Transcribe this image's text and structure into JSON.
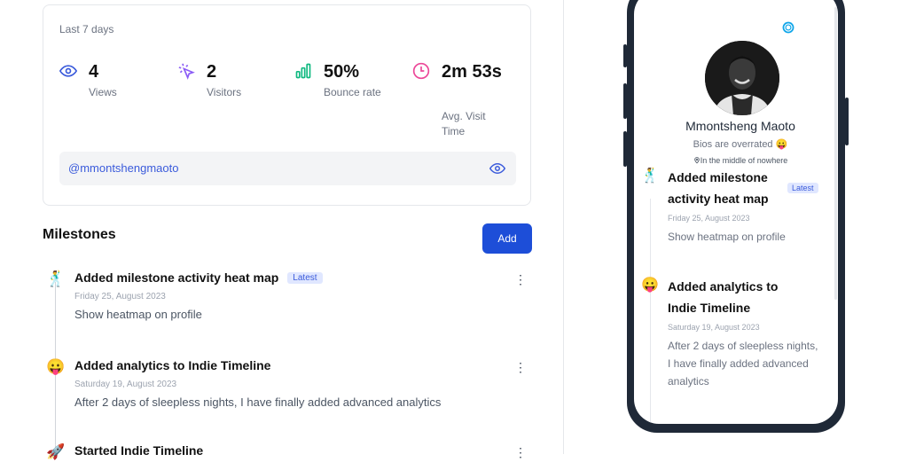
{
  "stats": {
    "period": "Last 7 days",
    "items": [
      {
        "value": "4",
        "label": "Views",
        "icon": "eye-icon",
        "color": "#3b5bdb"
      },
      {
        "value": "2",
        "label": "Visitors",
        "icon": "pointer-click-icon",
        "color": "#8b5cf6"
      },
      {
        "value": "50%",
        "label": "Bounce rate",
        "icon": "bar-chart-icon",
        "color": "#10b981"
      },
      {
        "value": "2m 53s",
        "label": "Avg. Visit Time",
        "icon": "clock-icon",
        "color": "#ec4899"
      }
    ],
    "handle": "@mmontshengmaoto"
  },
  "milestones": {
    "title": "Milestones",
    "add_label": "Add",
    "items": [
      {
        "title": "Added milestone activity heat map",
        "badge": "Latest",
        "date": "Friday 25, August 2023",
        "desc": "Show heatmap on profile",
        "emoji": "🕺"
      },
      {
        "title": "Added analytics to Indie Timeline",
        "date": "Saturday 19, August 2023",
        "desc": "After 2 days of sleepless nights, I have finally added advanced  analytics",
        "emoji": "😛"
      },
      {
        "title": "Started Indie Timeline",
        "emoji": "🚀"
      }
    ]
  },
  "phone": {
    "name": "Mmontsheng Maoto",
    "bio": "Bios are overrated 😛",
    "location": "In the middle of nowhere",
    "items": [
      {
        "title": "Added milestone activity heat map",
        "badge": "Latest",
        "date": "Friday 25, August 2023",
        "desc": "Show heatmap on profile",
        "emoji": "🕺"
      },
      {
        "title": "Added analytics to Indie Timeline",
        "date": "Saturday 19, August 2023",
        "desc": "After 2 days of sleepless nights, I have finally added advanced  analytics",
        "emoji": "😛"
      }
    ]
  },
  "colors": {
    "accent": "#1d4ed8",
    "phone_frame": "#1f2937"
  }
}
